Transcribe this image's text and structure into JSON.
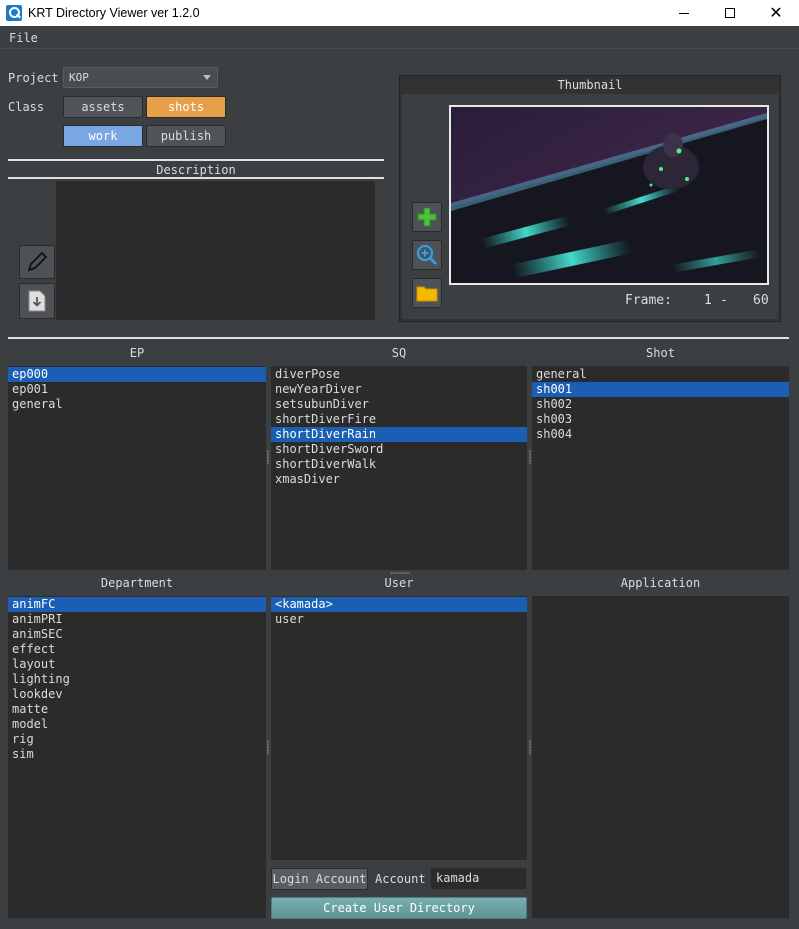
{
  "window": {
    "title": "KRT Directory Viewer   ver 1.2.0"
  },
  "menu": {
    "file": "File"
  },
  "project": {
    "label": "Project",
    "value": "KOP"
  },
  "class_row": {
    "label": "Class",
    "assets": "assets",
    "shots": "shots",
    "work": "work",
    "publish": "publish"
  },
  "description": {
    "title": "Description",
    "text": ""
  },
  "thumbnail": {
    "title": "Thumbnail",
    "frame_label": "Frame:",
    "frame_start": "1",
    "frame_sep": "-",
    "frame_end": "60"
  },
  "ep": {
    "title": "EP",
    "items": [
      "ep000",
      "ep001",
      "general"
    ],
    "selected": 0
  },
  "sq": {
    "title": "SQ",
    "items": [
      "diverPose",
      "newYearDiver",
      "setsubunDiver",
      "shortDiverFire",
      "shortDiverRain",
      "shortDiverSword",
      "shortDiverWalk",
      "xmasDiver"
    ],
    "selected": 4
  },
  "shot": {
    "title": "Shot",
    "items": [
      "general",
      "sh001",
      "sh002",
      "sh003",
      "sh004"
    ],
    "selected": 1
  },
  "department": {
    "title": "Department",
    "items": [
      "animFC",
      "animPRI",
      "animSEC",
      "effect",
      "layout",
      "lighting",
      "lookdev",
      "matte",
      "model",
      "rig",
      "sim"
    ],
    "selected": 0
  },
  "user": {
    "title": "User",
    "items": [
      "<kamada>",
      "user"
    ],
    "selected": 0,
    "login_button": "Login Account",
    "account_label": "Account",
    "account_value": "kamada",
    "create_button": "Create User Directory"
  },
  "application": {
    "title": "Application",
    "items": []
  },
  "colors": {
    "accent_orange": "#e6a04a",
    "accent_blue": "#7aa7e3",
    "selection": "#1a5fb4",
    "teal": "#6ea3a5"
  },
  "icons": {
    "app": "magnifier-icon",
    "edit": "pencil-icon",
    "save": "download-doc-icon",
    "add": "plus-icon",
    "zoom": "zoom-in-icon",
    "folder": "folder-icon"
  }
}
